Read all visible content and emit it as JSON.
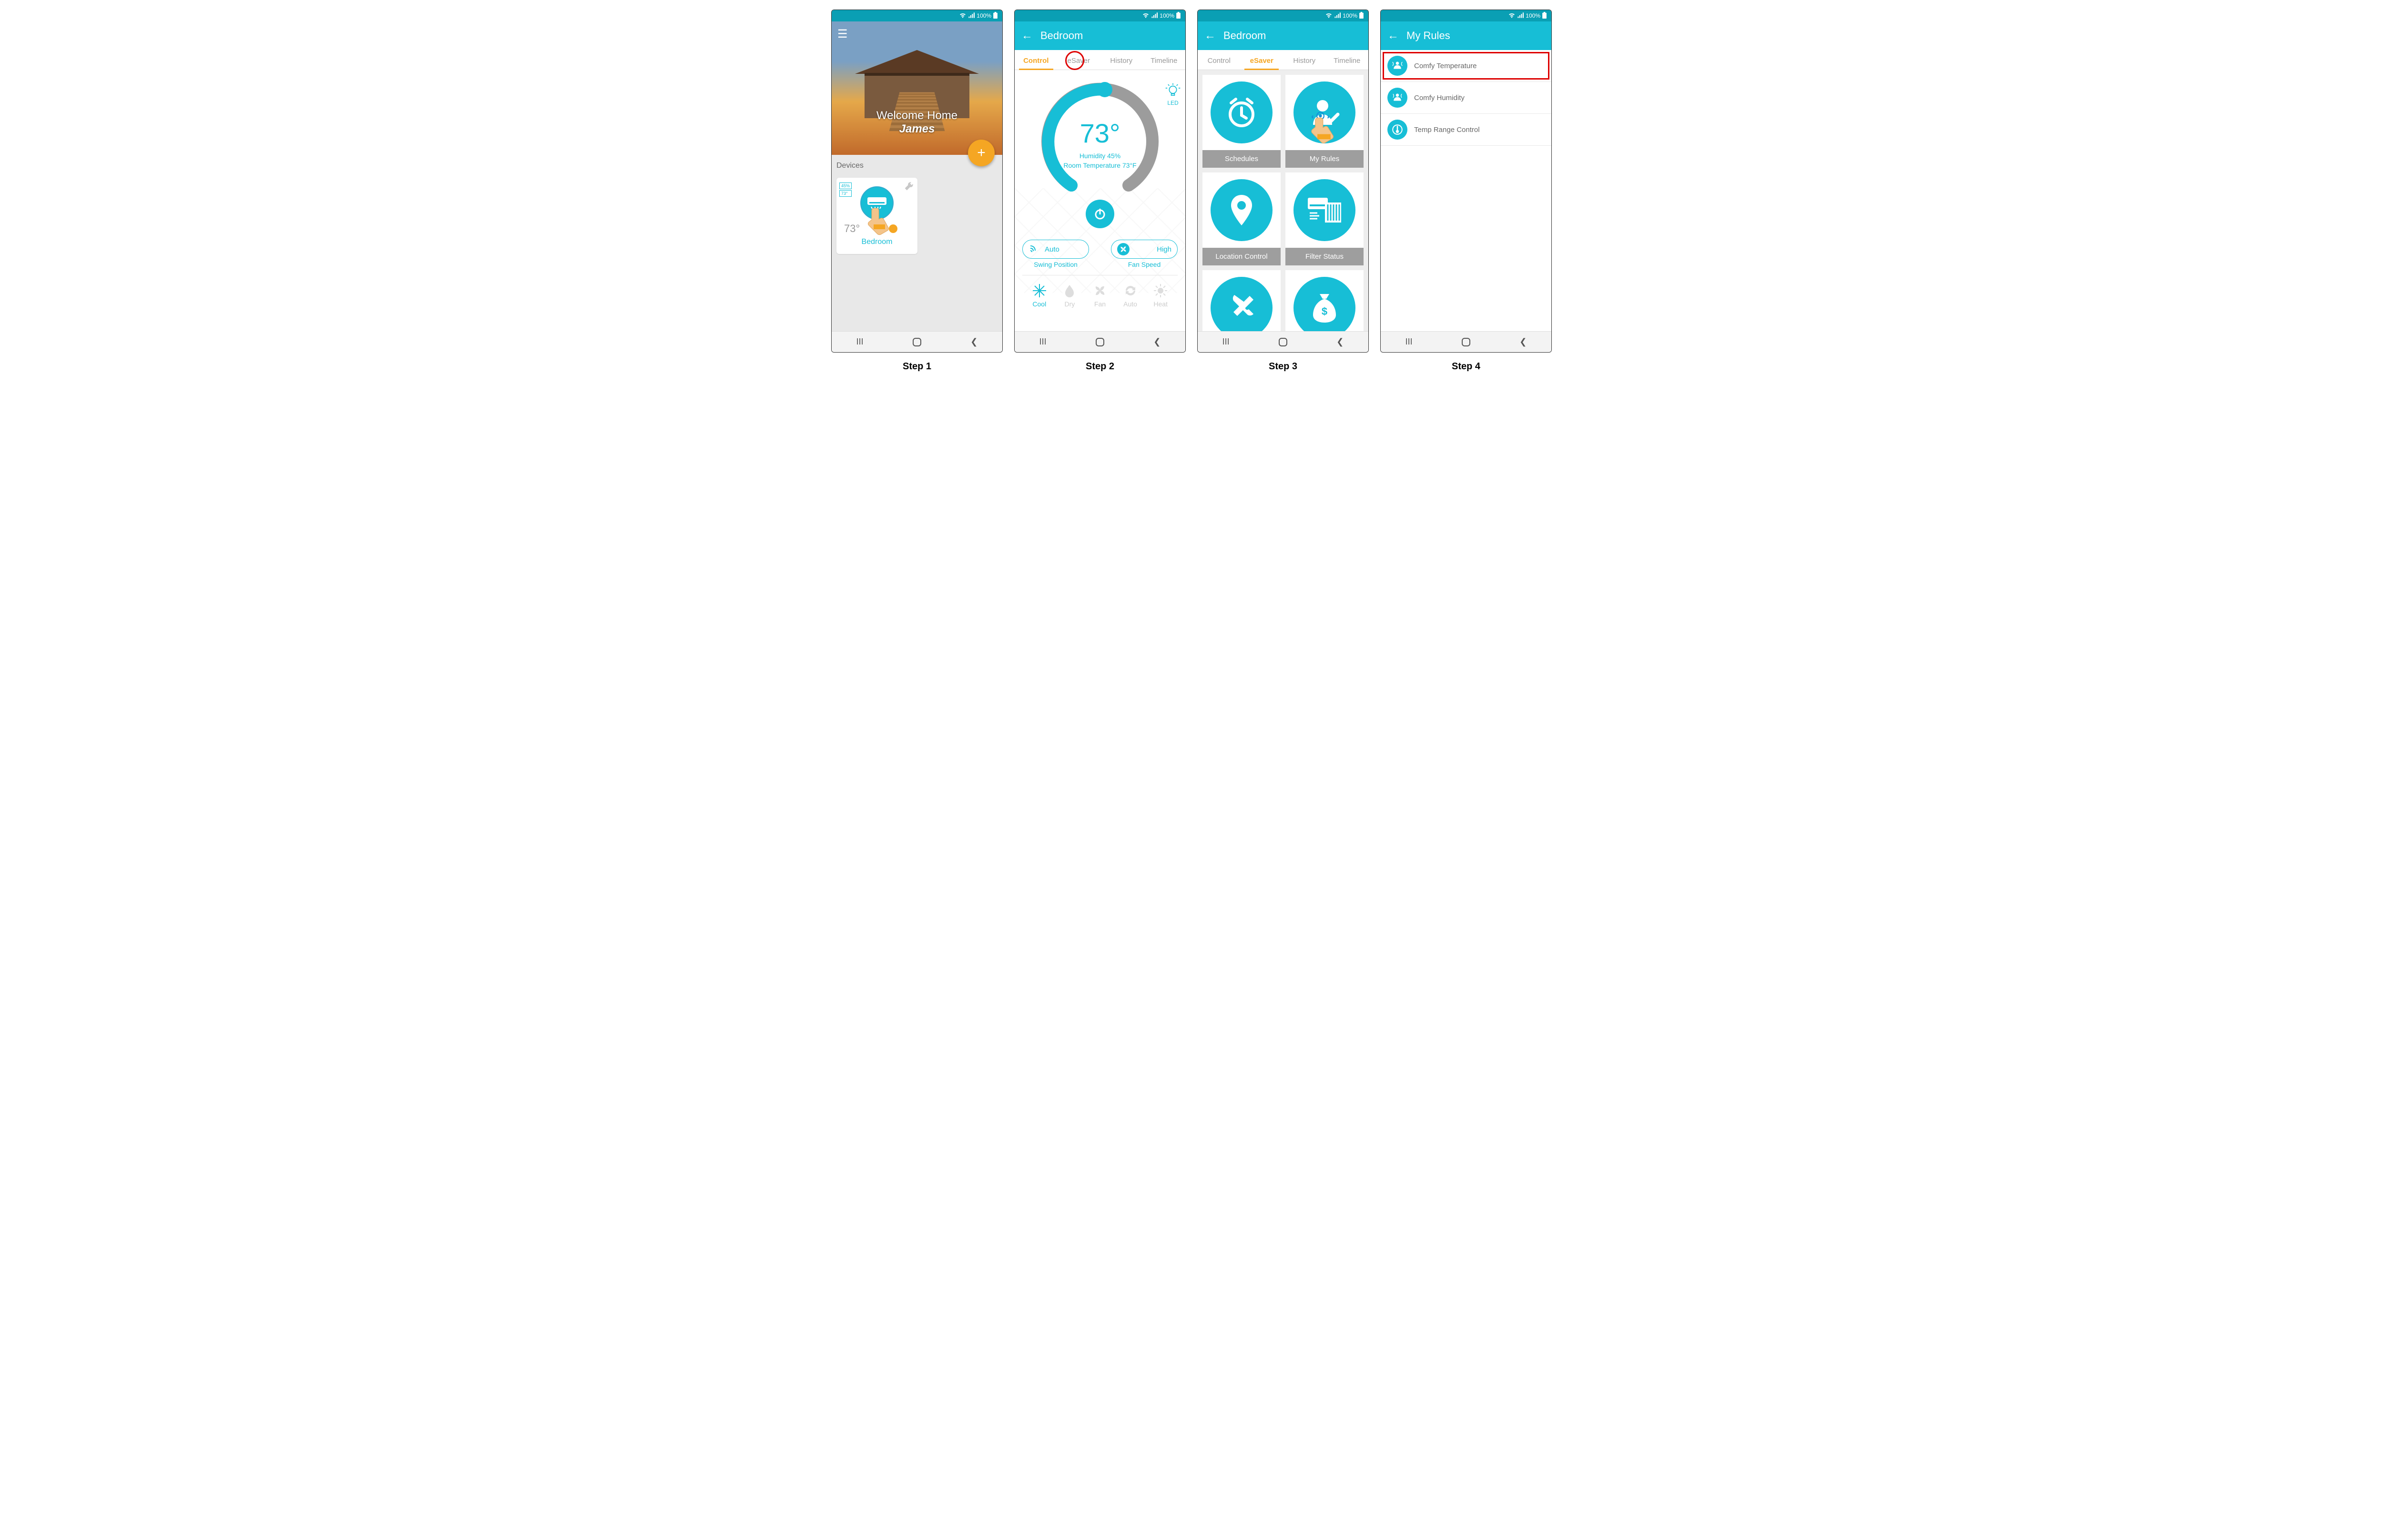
{
  "status": {
    "battery": "100%",
    "wifi_icon": "wifi",
    "signal_icon": "signal",
    "batt_icon": "battery"
  },
  "steps": {
    "s1": "Step 1",
    "s2": "Step 2",
    "s3": "Step 3",
    "s4": "Step 4"
  },
  "screen1": {
    "welcome_line": "Welcome Home",
    "user_name": "James",
    "devices_header": "Devices",
    "device": {
      "humidity_tag": "45%",
      "temp_tag": "73°",
      "temp": "73°",
      "room": "Bedroom"
    }
  },
  "screen2": {
    "title": "Bedroom",
    "tabs": {
      "control": "Control",
      "esaver": "eSaver",
      "history": "History",
      "timeline": "Timeline"
    },
    "active_tab": "control",
    "led_label": "LED",
    "set_temp": "73°",
    "humidity_line": "Humidity 45%",
    "room_temp_line": "Room Temperature 73°F",
    "swing": {
      "value": "Auto",
      "label": "Swing Position"
    },
    "fan": {
      "value": "High",
      "label": "Fan Speed"
    },
    "modes": {
      "cool": "Cool",
      "dry": "Dry",
      "fan": "Fan",
      "auto": "Auto",
      "heat": "Heat"
    }
  },
  "screen3": {
    "title": "Bedroom",
    "tabs": {
      "control": "Control",
      "esaver": "eSaver",
      "history": "History",
      "timeline": "Timeline"
    },
    "active_tab": "esaver",
    "tiles": {
      "schedules": "Schedules",
      "myrules": "My Rules",
      "location": "Location Control",
      "filter": "Filter Status",
      "tools": "",
      "savings": ""
    }
  },
  "screen4": {
    "title": "My Rules",
    "rules": {
      "comfy_temp": "Comfy Temperature",
      "comfy_hum": "Comfy Humidity",
      "temp_range": "Temp Range Control"
    }
  }
}
